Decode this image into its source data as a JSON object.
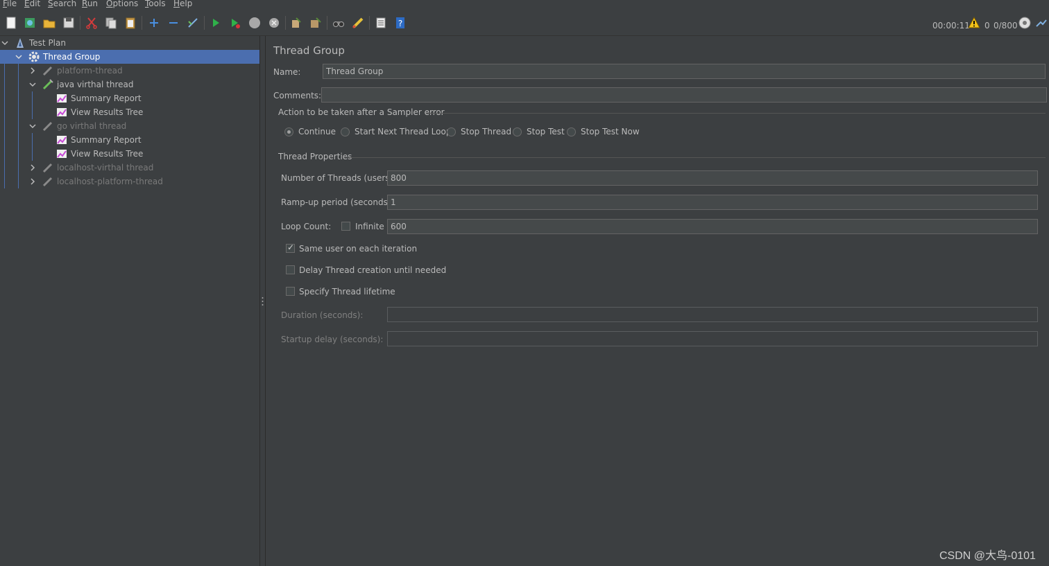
{
  "menu": [
    "File",
    "Edit",
    "Search",
    "Run",
    "Options",
    "Tools",
    "Help"
  ],
  "menu_mnemonics": [
    "F",
    "E",
    "S",
    "R",
    "O",
    "T",
    "H"
  ],
  "menu_rest": [
    "ile",
    "dit",
    "earch",
    "un",
    "ptions",
    "ools",
    "elp"
  ],
  "toolbar": {
    "icons": [
      "new-icon",
      "templates-icon",
      "open-icon",
      "save-icon",
      "cut-icon",
      "copy-icon",
      "paste-icon",
      "expand-icon",
      "collapse-icon",
      "toggle-icon",
      "start-icon",
      "start-no-pause-icon",
      "stop-icon",
      "shutdown-icon",
      "clear-icon",
      "clear-all-icon",
      "search-icon",
      "reset-search-icon",
      "function-helper-icon",
      "help-icon"
    ],
    "elapsed": "00:00:11",
    "warning_count": "0",
    "threads": "0/800"
  },
  "tree": [
    {
      "label": "Test Plan",
      "icon": "test-plan-icon",
      "level": 0,
      "expanded": true,
      "disabled": false
    },
    {
      "label": "Thread Group",
      "icon": "gear-icon",
      "level": 1,
      "expanded": true,
      "disabled": false,
      "selected": true
    },
    {
      "label": "platform-thread",
      "icon": "pipette-icon",
      "level": 2,
      "expanded": false,
      "disabled": true
    },
    {
      "label": "java virthal thread",
      "icon": "pipette-icon",
      "level": 2,
      "expanded": true,
      "disabled": false
    },
    {
      "label": "Summary Report",
      "icon": "chart-icon",
      "level": 3,
      "disabled": false
    },
    {
      "label": "View Results Tree",
      "icon": "chart-icon",
      "level": 3,
      "disabled": false
    },
    {
      "label": "go virthal thread",
      "icon": "pipette-icon",
      "level": 2,
      "expanded": true,
      "disabled": true
    },
    {
      "label": "Summary Report",
      "icon": "chart-icon",
      "level": 3,
      "disabled": false
    },
    {
      "label": "View Results Tree",
      "icon": "chart-icon",
      "level": 3,
      "disabled": false
    },
    {
      "label": "localhost-virthal thread",
      "icon": "pipette-icon",
      "level": 2,
      "expanded": false,
      "disabled": true
    },
    {
      "label": "localhost-platform-thread",
      "icon": "pipette-icon",
      "level": 2,
      "expanded": false,
      "disabled": true
    }
  ],
  "form": {
    "title": "Thread Group",
    "name_label": "Name:",
    "name_value": "Thread Group",
    "comments_label": "Comments:",
    "comments_value": "",
    "action_group_label": "Action to be taken after a Sampler error",
    "actions": [
      {
        "label": "Continue",
        "selected": true
      },
      {
        "label": "Start Next Thread Loop",
        "selected": false
      },
      {
        "label": "Stop Thread",
        "selected": false
      },
      {
        "label": "Stop Test",
        "selected": false
      },
      {
        "label": "Stop Test Now",
        "selected": false
      }
    ],
    "props_group_label": "Thread Properties",
    "threads_label": "Number of Threads (users):",
    "threads_value": "800",
    "rampup_label": "Ramp-up period (seconds):",
    "rampup_value": "1",
    "loop_label": "Loop Count:",
    "infinite_label": "Infinite",
    "infinite_checked": false,
    "loop_value": "600",
    "same_user_label": "Same user on each iteration",
    "same_user_checked": true,
    "delay_label": "Delay Thread creation until needed",
    "delay_checked": false,
    "lifetime_label": "Specify Thread lifetime",
    "lifetime_checked": false,
    "duration_label": "Duration (seconds):",
    "duration_value": "",
    "startup_label": "Startup delay (seconds):",
    "startup_value": ""
  },
  "watermark": "CSDN @大鸟-0101"
}
